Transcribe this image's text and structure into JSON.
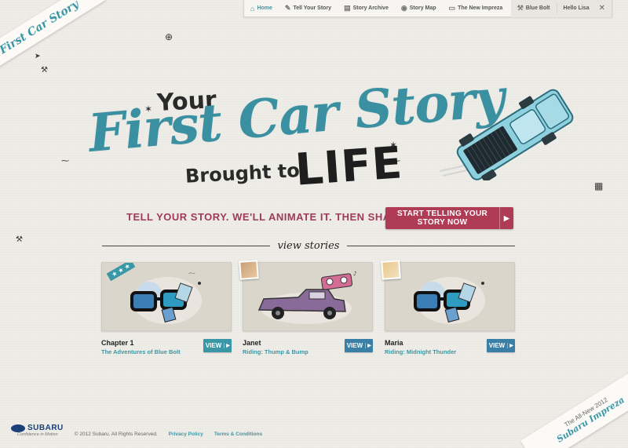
{
  "brand": {
    "corner_title": "First Car Story"
  },
  "nav": {
    "items": [
      {
        "label": "Home",
        "icon": "home-icon",
        "active": true
      },
      {
        "label": "Tell Your Story",
        "icon": "pencil-icon"
      },
      {
        "label": "Story Archive",
        "icon": "archive-icon"
      },
      {
        "label": "Story Map",
        "icon": "compass-icon"
      },
      {
        "label": "The New Impreza",
        "icon": "car-icon"
      }
    ],
    "profile_label": "Blue Bolt",
    "greeting": "Hello Lisa",
    "close_glyph": "✕"
  },
  "hero": {
    "line_your": "Your",
    "line_main": "First Car Story",
    "line_brought": "Brought to",
    "line_life": "LIFE"
  },
  "tagline": "TELL YOUR STORY. WE'LL ANIMATE IT. THEN SHARE IT.",
  "cta": {
    "label": "START TELLING YOUR STORY NOW",
    "arrow": "▶"
  },
  "view_stories_label": "view stories",
  "stories": [
    {
      "title": "Chapter 1",
      "subtitle": "The Adventures of Blue Bolt",
      "button": "VIEW",
      "button_arrow": "▶"
    },
    {
      "title": "Janet",
      "subtitle": "Riding: Thump & Bump",
      "button": "VIEW",
      "button_arrow": "▶"
    },
    {
      "title": "Maria",
      "subtitle": "Riding: Midnight Thunder",
      "button": "VIEW",
      "button_arrow": "▶"
    }
  ],
  "stars_ribbon": "★ ★ ★",
  "footer": {
    "brand": "SUBARU",
    "brand_tag": "Confidence in Motion",
    "copyright": "© 2012 Subaru. All Rights Reserved.",
    "privacy": "Privacy Policy",
    "terms": "Terms & Conditions"
  },
  "corner_promo": {
    "line1": "The All-New 2012",
    "line2": "Subaru Impreza"
  },
  "colors": {
    "teal": "#3a98a6",
    "cta": "#b03b55",
    "tagline": "#a03a5a"
  }
}
